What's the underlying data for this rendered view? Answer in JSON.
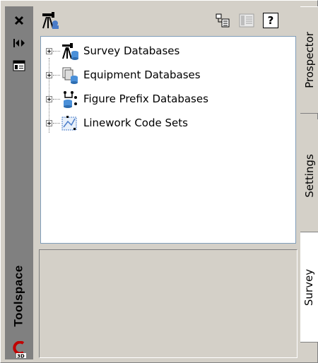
{
  "palette": {
    "title": "Toolspace",
    "toolbar": {
      "main_icon": "survey-toolbar-icon",
      "buttons": [
        {
          "name": "display-mode-button",
          "icon": "list-view-icon"
        },
        {
          "name": "item-view-button",
          "icon": "item-view-icon"
        },
        {
          "name": "help-button",
          "label": "?"
        }
      ]
    },
    "tree": [
      {
        "label": "Survey Databases",
        "icon": "survey-database-icon"
      },
      {
        "label": "Equipment Databases",
        "icon": "equipment-database-icon"
      },
      {
        "label": "Figure Prefix Databases",
        "icon": "figure-prefix-database-icon"
      },
      {
        "label": "Linework Code Sets",
        "icon": "linework-code-set-icon"
      }
    ],
    "tabs": [
      {
        "label": "Prospector"
      },
      {
        "label": "Settings"
      },
      {
        "label": "Survey"
      }
    ],
    "colors": {
      "titlebar": "#808080",
      "panel": "#d4d0c8",
      "tree_border": "#7f9db9"
    }
  }
}
